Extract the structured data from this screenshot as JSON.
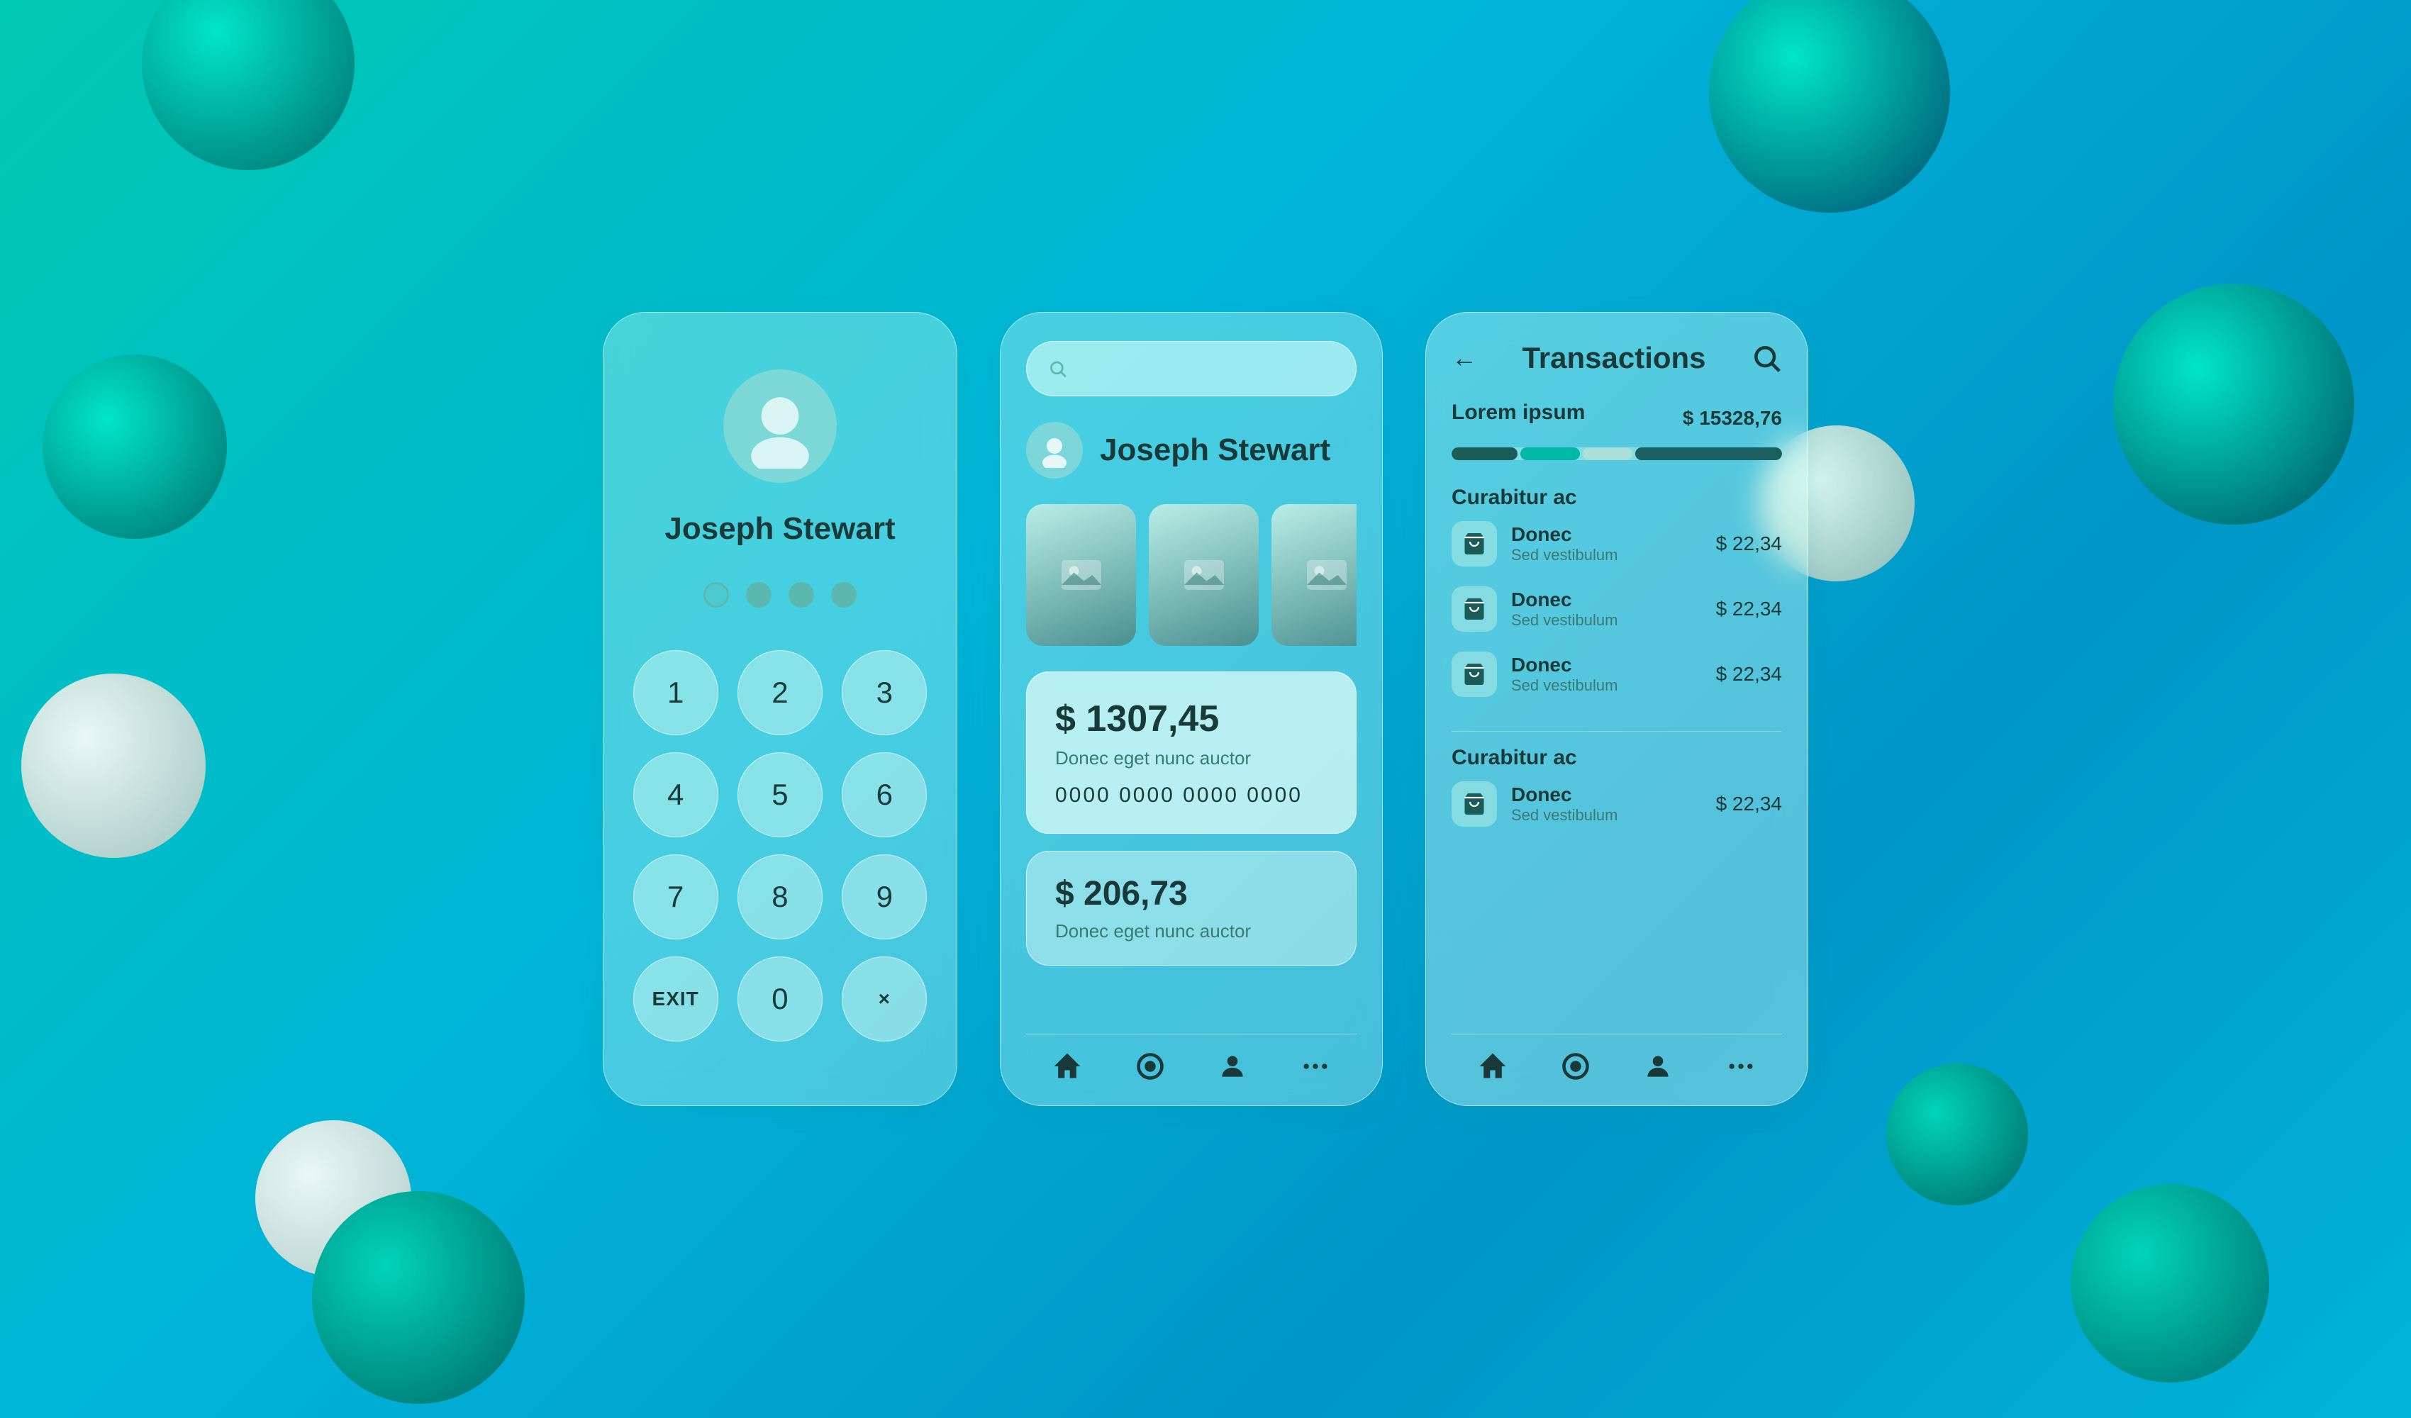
{
  "background": {
    "color_start": "#00c9b1",
    "color_end": "#0096c7"
  },
  "card_pin": {
    "user_name": "Joseph Stewart",
    "pin_dots": [
      {
        "state": "active"
      },
      {
        "state": "filled"
      },
      {
        "state": "filled"
      },
      {
        "state": "filled"
      }
    ],
    "keys": [
      {
        "value": "1"
      },
      {
        "value": "2"
      },
      {
        "value": "3"
      },
      {
        "value": "4"
      },
      {
        "value": "5"
      },
      {
        "value": "6"
      },
      {
        "value": "7"
      },
      {
        "value": "8"
      },
      {
        "value": "9"
      },
      {
        "value": "EXIT"
      },
      {
        "value": "0"
      },
      {
        "value": "×"
      }
    ]
  },
  "card_main": {
    "search_placeholder": "",
    "user_name": "Joseph Stewart",
    "balance_1": {
      "amount": "$ 1307,45",
      "label": "Donec eget nunc auctor",
      "card_number": "0000 0000 0000 0000"
    },
    "balance_2": {
      "amount": "$ 206,73",
      "label": "Donec eget nunc auctor"
    },
    "nav_items": [
      "home",
      "circle",
      "user",
      "more"
    ]
  },
  "card_transactions": {
    "title": "Transactions",
    "back_arrow": "←",
    "section1": {
      "label": "Lorem ipsum",
      "amount": "$ 15328,76",
      "progress": [
        {
          "width": 20,
          "type": "dark"
        },
        {
          "width": 18,
          "type": "teal"
        },
        {
          "width": 15,
          "type": "light"
        },
        {
          "width": 40,
          "type": "dark2"
        }
      ]
    },
    "section2_label": "Curabitur ac",
    "transactions_1": [
      {
        "name": "Donec",
        "sub": "Sed vestibulum",
        "amount": "$ 22,34"
      },
      {
        "name": "Donec",
        "sub": "Sed vestibulum",
        "amount": "$ 22,34"
      },
      {
        "name": "Donec",
        "sub": "Sed vestibulum",
        "amount": "$ 22,34"
      }
    ],
    "section3_label": "Curabitur ac",
    "transactions_2": [
      {
        "name": "Donec",
        "sub": "Sed vestibulum",
        "amount": "$ 22,34"
      }
    ],
    "nav_items": [
      "home",
      "circle",
      "user",
      "more"
    ]
  }
}
